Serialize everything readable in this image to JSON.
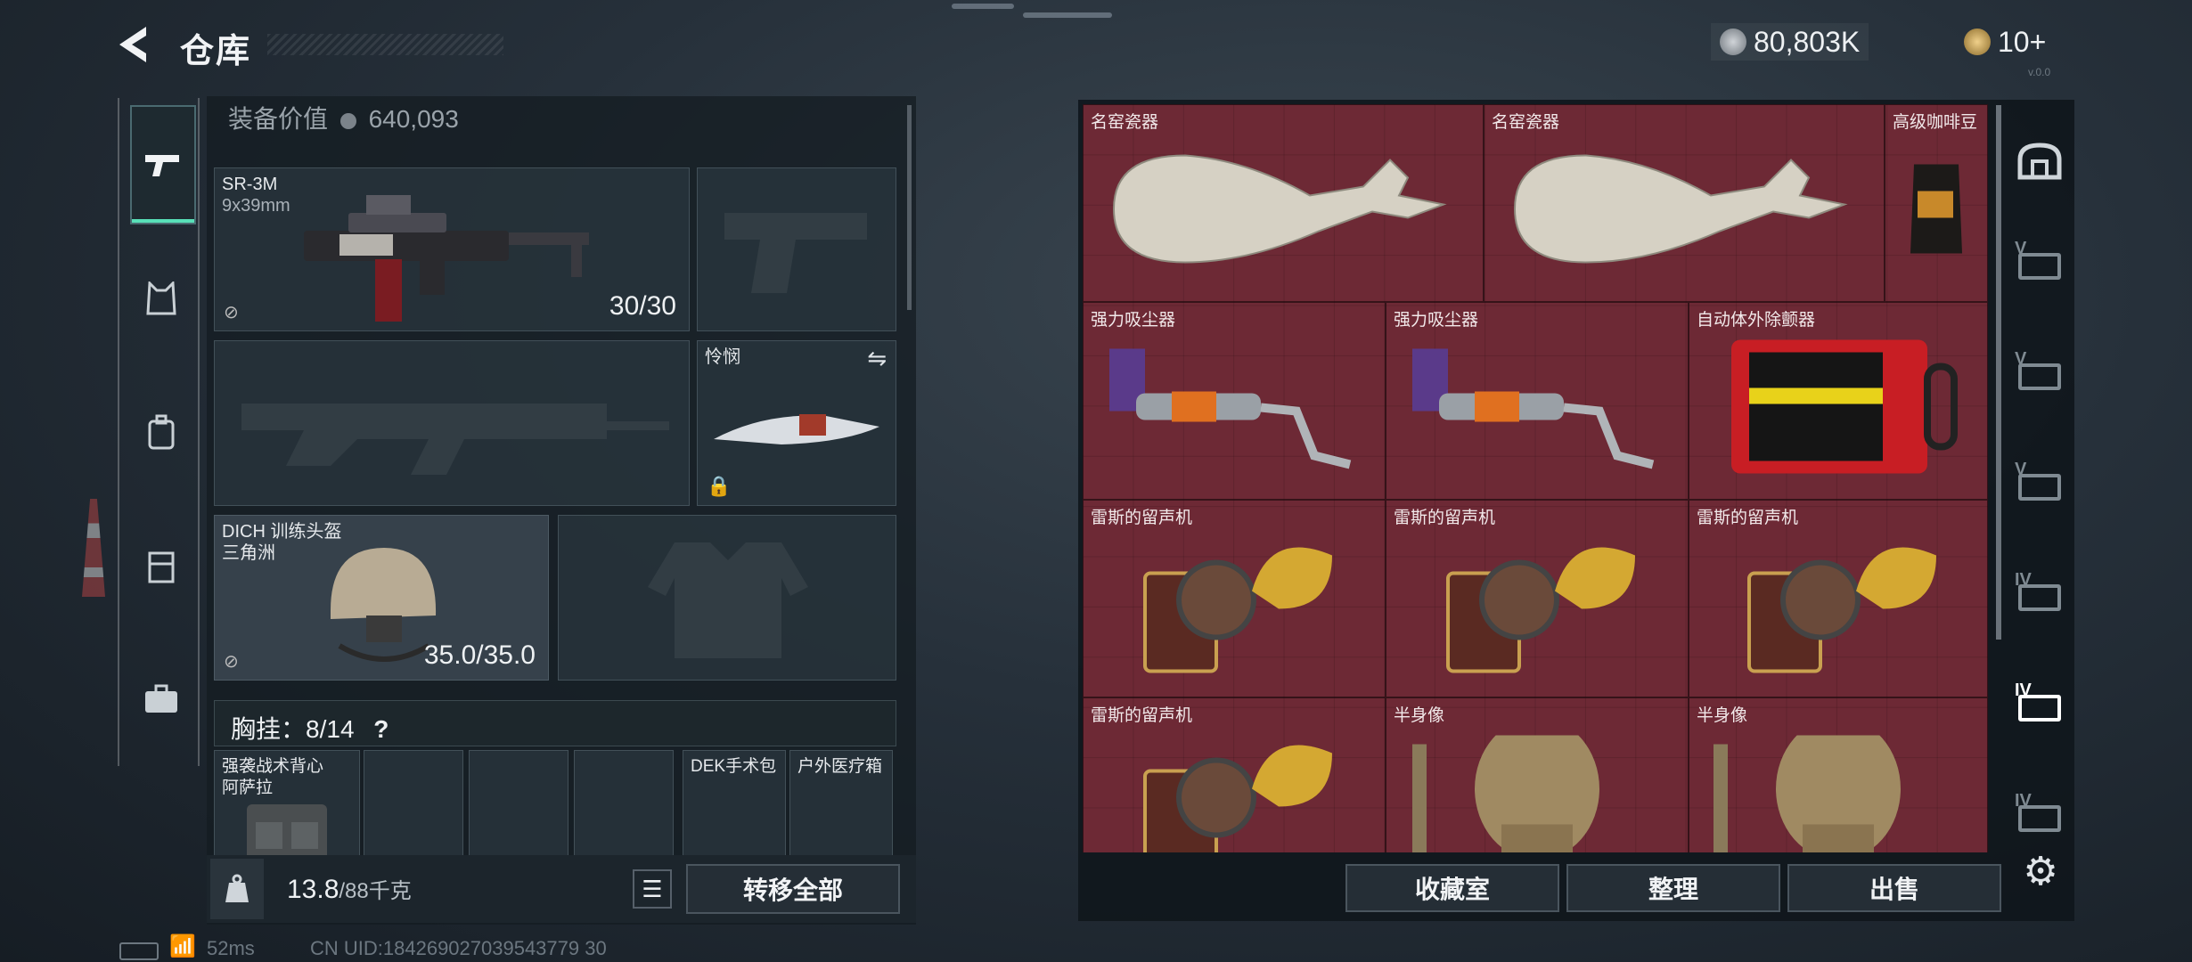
{
  "header": {
    "title": "仓库",
    "currency1": "80,803K",
    "currency2": "10+",
    "version": "v.0.0"
  },
  "equipment": {
    "value_label": "装备价值",
    "value": "640,093",
    "primary_weapon": {
      "name": "SR-3M",
      "ammo": "9x39mm",
      "durability": "30/30"
    },
    "melee": {
      "name": "怜悯"
    },
    "helmet": {
      "name": "DICH 训练头盔",
      "brand": "三角洲",
      "durability": "35.0/35.0"
    },
    "chest_rig": {
      "label": "胸挂：",
      "capacity": "8/14",
      "help": "?"
    },
    "backpack": {
      "name": "强袭战术背心",
      "brand": "阿萨拉"
    },
    "pouch1": "DEK手术包",
    "pouch2": "户外医疗箱",
    "weight": "13.8",
    "weight_max": "/88千克",
    "transfer_all": "转移全部"
  },
  "storage": {
    "items": [
      {
        "name": "名窑瓷器"
      },
      {
        "name": "名窑瓷器"
      },
      {
        "name": "高级咖啡豆"
      },
      {
        "name": "强力吸尘器"
      },
      {
        "name": "强力吸尘器"
      },
      {
        "name": "自动体外除颤器"
      },
      {
        "name": "雷斯的留声机"
      },
      {
        "name": "雷斯的留声机"
      },
      {
        "name": "雷斯的留声机"
      },
      {
        "name": "雷斯的留声机"
      },
      {
        "name": "半身像"
      },
      {
        "name": "半身像"
      }
    ],
    "buttons": {
      "collection": "收藏室",
      "sort": "整理",
      "sell": "出售"
    },
    "tabs": [
      "V",
      "V",
      "V",
      "IV",
      "IV",
      "IV"
    ]
  },
  "status_bar": {
    "ping": "52ms",
    "uid": "CN UID:184269027039543779 30"
  },
  "colors": {
    "accent": "#58e0b8",
    "storage_bg": "#6a2a34"
  }
}
